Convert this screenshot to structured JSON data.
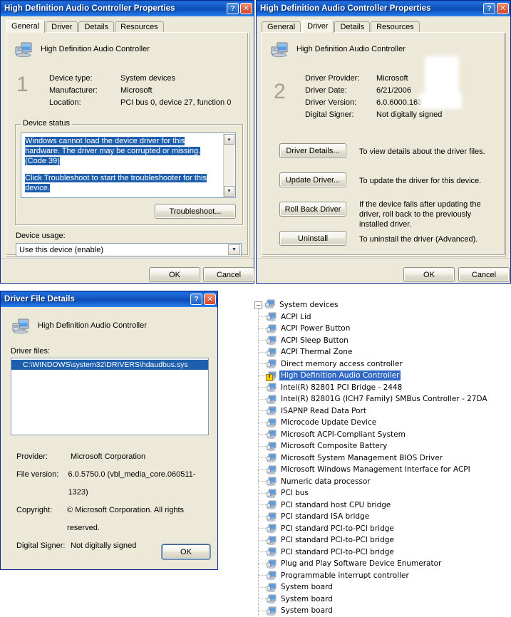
{
  "colors": {
    "title_blue": "#0b4ab4",
    "dialog_face": "#ece9d8",
    "selection_blue": "#316ac5",
    "status_selection": "#1e5fad",
    "warning_yellow": "#ffd400"
  },
  "dialog_general": {
    "title": "High Definition Audio Controller Properties",
    "marker": "1",
    "help_button": "?",
    "close_button": "✕",
    "tabs": [
      {
        "label": "General",
        "active": true
      },
      {
        "label": "Driver",
        "active": false
      },
      {
        "label": "Details",
        "active": false
      },
      {
        "label": "Resources",
        "active": false
      }
    ],
    "device_name": "High Definition Audio Controller",
    "fields": [
      {
        "label": "Device type:",
        "value": "System devices"
      },
      {
        "label": "Manufacturer:",
        "value": "Microsoft"
      },
      {
        "label": "Location:",
        "value": "PCI bus 0, device 27, function 0"
      }
    ],
    "status_group_label": "Device status",
    "status_lines": [
      "Windows cannot load the device driver for this hardware. The driver may be corrupted or missing. (Code 39)",
      "Click Troubleshoot to start the troubleshooter for this device."
    ],
    "troubleshoot_button": "Troubleshoot...",
    "device_usage_label": "Device usage:",
    "device_usage_value": "Use this device (enable)",
    "ok_button": "OK",
    "cancel_button": "Cancel"
  },
  "dialog_driver": {
    "title": "High Definition Audio Controller Properties",
    "marker": "2",
    "help_button": "?",
    "close_button": "✕",
    "tabs": [
      {
        "label": "General",
        "active": false
      },
      {
        "label": "Driver",
        "active": true
      },
      {
        "label": "Details",
        "active": false
      },
      {
        "label": "Resources",
        "active": false
      }
    ],
    "device_name": "High Definition Audio Controller",
    "fields": [
      {
        "label": "Driver Provider:",
        "value": "Microsoft"
      },
      {
        "label": "Driver Date:",
        "value": "6/21/2006"
      },
      {
        "label": "Driver Version:",
        "value": "6.0.6000.16386"
      },
      {
        "label": "Digital Signer:",
        "value": "Not digitally signed"
      }
    ],
    "actions": [
      {
        "button": "Driver Details...",
        "description": "To view details about the driver files."
      },
      {
        "button": "Update Driver...",
        "description": "To update the driver for this device."
      },
      {
        "button": "Roll Back Driver",
        "description": "If the device fails after updating the driver, roll back to the previously installed driver."
      },
      {
        "button": "Uninstall",
        "description": "To uninstall the driver (Advanced)."
      }
    ],
    "ok_button": "OK",
    "cancel_button": "Cancel"
  },
  "dialog_file_details": {
    "title": "Driver File Details",
    "help_button": "?",
    "close_button": "✕",
    "device_name": "High Definition Audio Controller",
    "driver_files_label": "Driver files:",
    "files": [
      "C:\\WINDOWS\\system32\\DRIVERS\\hdaudbus.sys"
    ],
    "fields": [
      {
        "label": "Provider:",
        "value": "Microsoft Corporation"
      },
      {
        "label": "File version:",
        "value": "6.0.5750.0 (vbl_media_core.060511-1323)"
      },
      {
        "label": "Copyright:",
        "value": "© Microsoft Corporation. All rights reserved."
      },
      {
        "label": "Digital Signer:",
        "value": "Not digitally signed"
      }
    ],
    "ok_button": "OK"
  },
  "device_tree": {
    "root": "System devices",
    "root_expanded": true,
    "items": [
      {
        "label": "ACPI Lid",
        "selected": false,
        "warning": false
      },
      {
        "label": "ACPI Power Button",
        "selected": false,
        "warning": false
      },
      {
        "label": "ACPI Sleep Button",
        "selected": false,
        "warning": false
      },
      {
        "label": "ACPI Thermal Zone",
        "selected": false,
        "warning": false
      },
      {
        "label": "Direct memory access controller",
        "selected": false,
        "warning": false
      },
      {
        "label": "High Definition Audio Controller",
        "selected": true,
        "warning": true
      },
      {
        "label": "Intel(R) 82801 PCI Bridge - 2448",
        "selected": false,
        "warning": false
      },
      {
        "label": "Intel(R) 82801G (ICH7 Family) SMBus Controller - 27DA",
        "selected": false,
        "warning": false
      },
      {
        "label": "ISAPNP Read Data Port",
        "selected": false,
        "warning": false
      },
      {
        "label": "Microcode Update Device",
        "selected": false,
        "warning": false
      },
      {
        "label": "Microsoft ACPI-Compliant System",
        "selected": false,
        "warning": false
      },
      {
        "label": "Microsoft Composite Battery",
        "selected": false,
        "warning": false
      },
      {
        "label": "Microsoft System Management BIOS Driver",
        "selected": false,
        "warning": false
      },
      {
        "label": "Microsoft Windows Management Interface for ACPI",
        "selected": false,
        "warning": false
      },
      {
        "label": "Numeric data processor",
        "selected": false,
        "warning": false
      },
      {
        "label": "PCI bus",
        "selected": false,
        "warning": false
      },
      {
        "label": "PCI standard host CPU bridge",
        "selected": false,
        "warning": false
      },
      {
        "label": "PCI standard ISA bridge",
        "selected": false,
        "warning": false
      },
      {
        "label": "PCI standard PCI-to-PCI bridge",
        "selected": false,
        "warning": false
      },
      {
        "label": "PCI standard PCI-to-PCI bridge",
        "selected": false,
        "warning": false
      },
      {
        "label": "PCI standard PCI-to-PCI bridge",
        "selected": false,
        "warning": false
      },
      {
        "label": "Plug and Play Software Device Enumerator",
        "selected": false,
        "warning": false
      },
      {
        "label": "Programmable interrupt controller",
        "selected": false,
        "warning": false
      },
      {
        "label": "System board",
        "selected": false,
        "warning": false
      },
      {
        "label": "System board",
        "selected": false,
        "warning": false
      },
      {
        "label": "System board",
        "selected": false,
        "warning": false
      }
    ]
  }
}
